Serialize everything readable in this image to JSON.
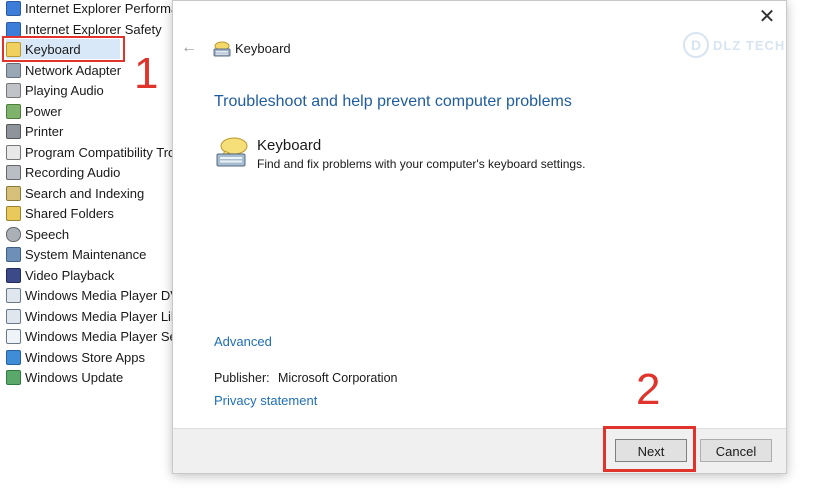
{
  "background_list": {
    "items": [
      {
        "label": "Internet Explorer Performa",
        "icon": "ie-icon"
      },
      {
        "label": "Internet Explorer Safety",
        "icon": "ie-icon"
      },
      {
        "label": "Keyboard",
        "icon": "keyboard-icon",
        "selected": true
      },
      {
        "label": "Network Adapter",
        "icon": "network-adapter-icon"
      },
      {
        "label": "Playing Audio",
        "icon": "audio-icon"
      },
      {
        "label": "Power",
        "icon": "power-icon"
      },
      {
        "label": "Printer",
        "icon": "printer-icon"
      },
      {
        "label": "Program Compatibility Tro",
        "icon": "program-compatibility-icon"
      },
      {
        "label": "Recording Audio",
        "icon": "recording-audio-icon"
      },
      {
        "label": "Search and Indexing",
        "icon": "search-indexing-icon"
      },
      {
        "label": "Shared Folders",
        "icon": "shared-folders-icon"
      },
      {
        "label": "Speech",
        "icon": "microphone-icon"
      },
      {
        "label": "System Maintenance",
        "icon": "system-maintenance-icon"
      },
      {
        "label": "Video Playback",
        "icon": "video-playback-icon"
      },
      {
        "label": "Windows Media Player DV",
        "icon": "media-player-icon"
      },
      {
        "label": "Windows Media Player Lib",
        "icon": "media-player-icon"
      },
      {
        "label": "Windows Media Player Se",
        "icon": "media-player-settings-icon"
      },
      {
        "label": "Windows Store Apps",
        "icon": "store-apps-icon"
      },
      {
        "label": "Windows Update",
        "icon": "windows-update-icon"
      }
    ]
  },
  "annotations": {
    "step1": "1",
    "step2": "2"
  },
  "watermark": {
    "logo": "D",
    "text": "DLZ TECH"
  },
  "dialog": {
    "header_title": "Keyboard",
    "heading": "Troubleshoot and help prevent computer problems",
    "troubleshooter": {
      "title": "Keyboard",
      "description": "Find and fix problems with your computer's keyboard settings."
    },
    "advanced_link": "Advanced",
    "publisher_label": "Publisher:",
    "publisher_value": "Microsoft Corporation",
    "privacy_link": "Privacy statement",
    "next_button": "Next",
    "cancel_button": "Cancel",
    "close_glyph": "✕",
    "back_glyph": "←"
  },
  "colors": {
    "heading": "#1f5da0",
    "link": "#1f6fb8",
    "annotation": "#e0332c",
    "footer_bg": "#f0f0f0"
  }
}
